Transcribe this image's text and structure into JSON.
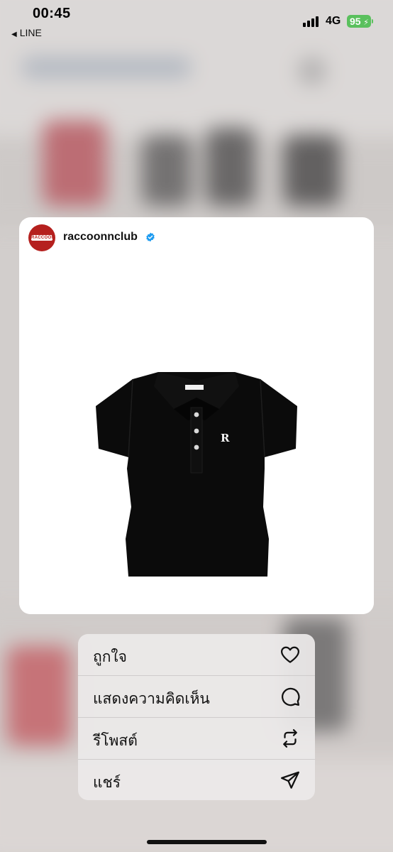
{
  "status_bar": {
    "time": "00:45",
    "back_app": "LINE",
    "network": "4G",
    "battery": "95"
  },
  "post": {
    "username": "raccoonnclub",
    "avatar_text": "RACCOON",
    "verified": true
  },
  "menu": {
    "items": [
      {
        "label": "ถูกใจ",
        "icon": "heart-icon"
      },
      {
        "label": "แสดงความคิดเห็น",
        "icon": "comment-icon"
      },
      {
        "label": "รีโพสต์",
        "icon": "repost-icon"
      },
      {
        "label": "แชร์",
        "icon": "share-icon"
      }
    ]
  },
  "colors": {
    "brand_red": "#b5201e",
    "verified_blue": "#1d9bf0",
    "battery_green": "#5ac05d"
  }
}
